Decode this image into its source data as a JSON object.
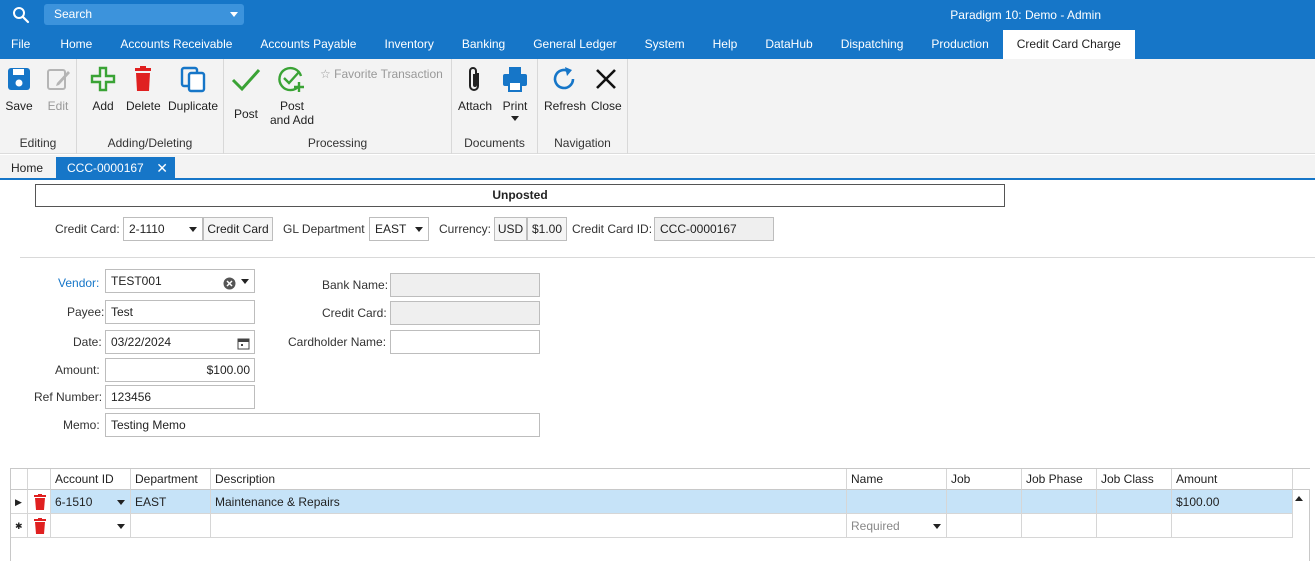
{
  "titlebar": {
    "search_placeholder": "Search",
    "app_title": "Paradigm 10: Demo - Admin"
  },
  "menu": {
    "items": [
      "File",
      "Home",
      "Accounts Receivable",
      "Accounts Payable",
      "Inventory",
      "Banking",
      "General Ledger",
      "System",
      "Help",
      "DataHub",
      "Dispatching",
      "Production",
      "Credit Card Charge"
    ],
    "active": "Credit Card Charge"
  },
  "ribbon": {
    "editing": {
      "label": "Editing",
      "save": "Save",
      "edit": "Edit"
    },
    "adding": {
      "label": "Adding/Deleting",
      "add": "Add",
      "delete": "Delete",
      "duplicate": "Duplicate"
    },
    "processing": {
      "label": "Processing",
      "post": "Post",
      "post_and_add_1": "Post",
      "post_and_add_2": "and Add",
      "favorite": "Favorite Transaction"
    },
    "documents": {
      "label": "Documents",
      "attach": "Attach",
      "print": "Print"
    },
    "navigation": {
      "label": "Navigation",
      "refresh": "Refresh",
      "close": "Close"
    },
    "colors": {
      "blue": "#1676c8",
      "green": "#3aa335",
      "red": "#e02020"
    }
  },
  "doctabs": {
    "home": "Home",
    "active": "CCC-0000167"
  },
  "form": {
    "status": "Unposted",
    "credit_card_label": "Credit Card:",
    "credit_card_value": "2-1110",
    "credit_card_name": "Credit Card",
    "gl_department_label": "GL Department",
    "gl_department_value": "EAST",
    "currency_label": "Currency:",
    "currency_code": "USD",
    "currency_rate": "$1.00",
    "cc_id_label": "Credit Card ID:",
    "cc_id_value": "CCC-0000167",
    "vendor_label": "Vendor:",
    "vendor_value": "TEST001",
    "payee_label": "Payee:",
    "payee_value": "Test",
    "date_label": "Date:",
    "date_value": "03/22/2024",
    "amount_label": "Amount:",
    "amount_value": "$100.00",
    "ref_label": "Ref Number:",
    "ref_value": "123456",
    "memo_label": "Memo:",
    "memo_value": "Testing Memo",
    "bank_name_label": "Bank Name:",
    "bank_name_value": "",
    "credit_card2_label": "Credit Card:",
    "credit_card2_value": "",
    "cardholder_label": "Cardholder Name:",
    "cardholder_value": ""
  },
  "grid": {
    "columns": [
      "Account ID",
      "Department",
      "Description",
      "Name",
      "Job",
      "Job Phase",
      "Job Class",
      "Amount"
    ],
    "rows": [
      {
        "account": "6-1510",
        "department": "EAST",
        "description": "Maintenance & Repairs",
        "name": "",
        "job": "",
        "job_phase": "",
        "job_class": "",
        "amount": "$100.00"
      }
    ],
    "new_row": {
      "name_placeholder": "Required"
    }
  }
}
